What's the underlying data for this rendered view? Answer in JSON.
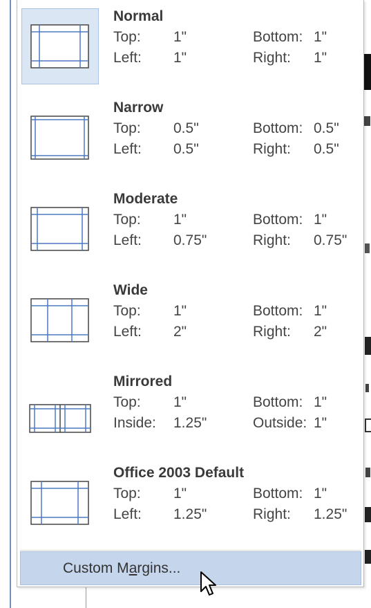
{
  "margins_menu": {
    "presets": [
      {
        "name": "Normal",
        "rows": [
          [
            "Top:",
            "1\"",
            "Bottom:",
            "1\""
          ],
          [
            "Left:",
            "1\"",
            "Right:",
            "1\""
          ]
        ],
        "icon": "margin-normal-icon"
      },
      {
        "name": "Narrow",
        "rows": [
          [
            "Top:",
            "0.5\"",
            "Bottom:",
            "0.5\""
          ],
          [
            "Left:",
            "0.5\"",
            "Right:",
            "0.5\""
          ]
        ],
        "icon": "margin-narrow-icon"
      },
      {
        "name": "Moderate",
        "rows": [
          [
            "Top:",
            "1\"",
            "Bottom:",
            "1\""
          ],
          [
            "Left:",
            "0.75\"",
            "Right:",
            "0.75\""
          ]
        ],
        "icon": "margin-moderate-icon"
      },
      {
        "name": "Wide",
        "rows": [
          [
            "Top:",
            "1\"",
            "Bottom:",
            "1\""
          ],
          [
            "Left:",
            "2\"",
            "Right:",
            "2\""
          ]
        ],
        "icon": "margin-wide-icon"
      },
      {
        "name": "Mirrored",
        "rows": [
          [
            "Top:",
            "1\"",
            "Bottom:",
            "1\""
          ],
          [
            "Inside:",
            "1.25\"",
            "Outside:",
            "1\""
          ]
        ],
        "icon": "margin-mirrored-icon"
      },
      {
        "name": "Office 2003 Default",
        "rows": [
          [
            "Top:",
            "1\"",
            "Bottom:",
            "1\""
          ],
          [
            "Left:",
            "1.25\"",
            "Right:",
            "1.25\""
          ]
        ],
        "icon": "margin-office2003-icon"
      }
    ],
    "selected_preset": "Normal",
    "custom_margins": {
      "before": "Custom M",
      "accel": "a",
      "after": "rgins..."
    }
  },
  "colors": {
    "selected_bg": "#dbe6f4",
    "hover_bg": "#c5d6ec",
    "guide_line": "#4a78c2"
  }
}
